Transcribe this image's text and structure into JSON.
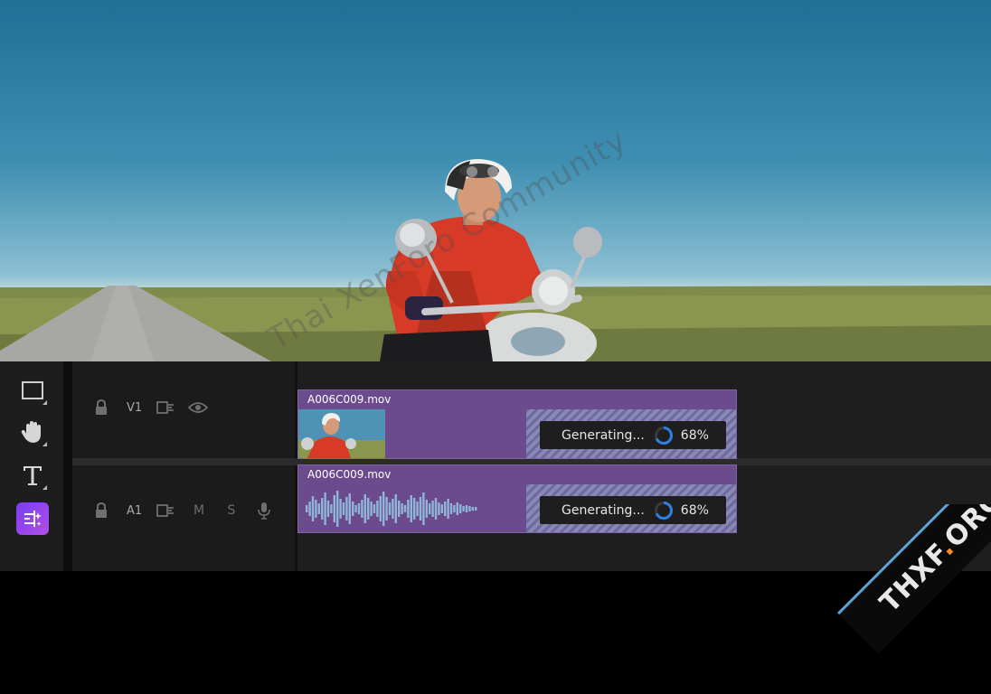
{
  "watermark": {
    "text": "Thai XenForo Community"
  },
  "badge": {
    "prefix": "THXF",
    "dot": ".",
    "suffix": "ORG"
  },
  "tools": [
    {
      "icon": "rectangle-select-icon",
      "active": false
    },
    {
      "icon": "hand-icon",
      "active": false
    },
    {
      "icon": "type-icon",
      "active": false
    },
    {
      "icon": "generative-extend-icon",
      "active": true
    }
  ],
  "tracks": {
    "video": {
      "label": "V1"
    },
    "audio": {
      "label": "A1",
      "mute": "M",
      "solo": "S"
    }
  },
  "clips": {
    "video": {
      "name": "A006C009.mov",
      "status": "Generating...",
      "progress": "68%",
      "progress_value": 0.68
    },
    "audio": {
      "name": "A006C009.mov",
      "status": "Generating...",
      "progress": "68%",
      "progress_value": 0.68
    }
  },
  "colors": {
    "clip": "#6b4a8d",
    "accent": "#2f7fe4",
    "active_tool": "#8a44ef",
    "waveform": "#8fb6d8"
  }
}
